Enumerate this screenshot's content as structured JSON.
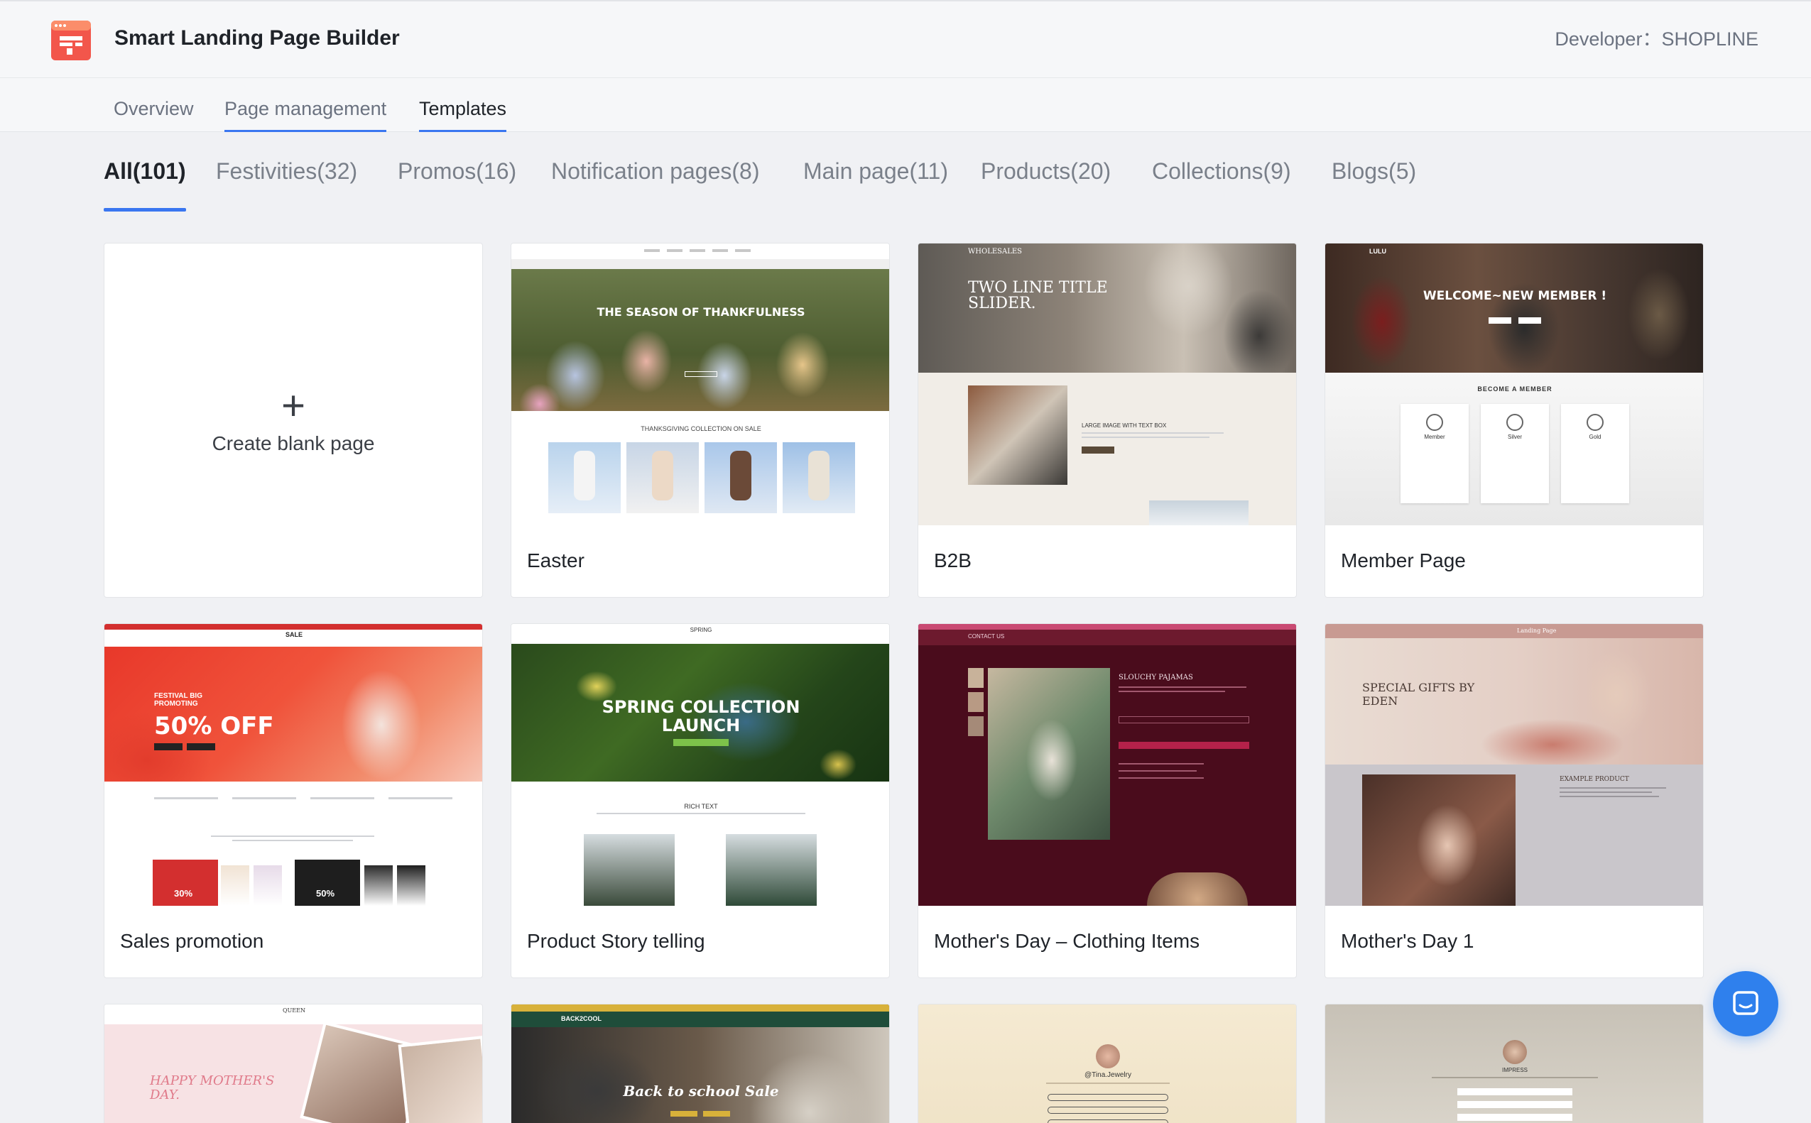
{
  "app": {
    "title": "Smart Landing Page Builder",
    "developer_label": "Developer：",
    "developer_name": "SHOPLINE",
    "logo_icon": "page-builder-logo-icon"
  },
  "nav": {
    "tabs": [
      {
        "label": "Overview"
      },
      {
        "label": "Page management"
      },
      {
        "label": "Templates"
      }
    ],
    "active": "Templates"
  },
  "categories": [
    {
      "label": "All(101)"
    },
    {
      "label": "Festivities(32)"
    },
    {
      "label": "Promos(16)"
    },
    {
      "label": "Notification pages(8)"
    },
    {
      "label": "Main page(11)"
    },
    {
      "label": "Products(20)"
    },
    {
      "label": "Collections(9)"
    },
    {
      "label": "Blogs(5)"
    }
  ],
  "blank": {
    "icon": "plus-icon",
    "label": "Create blank page"
  },
  "templates": [
    {
      "name": "Easter",
      "preview_text": "THE SEASON OF THANKFULNESS",
      "preview_sub": "THANKSGIVING COLLECTION ON SALE"
    },
    {
      "name": "B2B",
      "preview_text": "TWO LINE TITLE SLIDER.",
      "preview_sub": "LARGE IMAGE WITH TEXT BOX",
      "preview_brand": "WHOLESALES"
    },
    {
      "name": "Member Page",
      "preview_text": "WELCOME~NEW MEMBER !",
      "preview_sub": "BECOME A MEMBER",
      "preview_brand": "LULU",
      "tiers": [
        "Member",
        "Silver",
        "Gold"
      ]
    },
    {
      "name": "Sales promotion",
      "preview_text": "50% OFF",
      "preview_sub": "FESTIVAL BIG PROMOTING",
      "preview_brand": "SALE",
      "badges": [
        "30%",
        "50%"
      ]
    },
    {
      "name": "Product Story telling",
      "preview_text": "SPRING COLLECTION LAUNCH",
      "preview_sub": "RICH TEXT",
      "preview_brand": "SPRING"
    },
    {
      "name": "Mother's Day – Clothing Items",
      "preview_text": "SLOUCHY PAJAMAS",
      "preview_brand": "CONTACT US"
    },
    {
      "name": "Mother's Day 1",
      "preview_text": "SPECIAL GIFTS BY EDEN",
      "preview_sub": "EXAMPLE PRODUCT",
      "preview_brand": "Landing Page"
    },
    {
      "name": "",
      "preview_text": "HAPPY MOTHER'S DAY.",
      "preview_brand": "QUEEN"
    },
    {
      "name": "",
      "preview_text": "Back to school Sale",
      "preview_brand": "BACK2COOL"
    },
    {
      "name": "",
      "preview_text": "@Tina.Jewelry"
    },
    {
      "name": "",
      "preview_text": "IMPRESS"
    }
  ],
  "colors": {
    "accent": "#3a76f0",
    "chat_button": "#2f80ed",
    "logo": "#f2564b"
  },
  "chat": {
    "icon": "chat-icon"
  }
}
